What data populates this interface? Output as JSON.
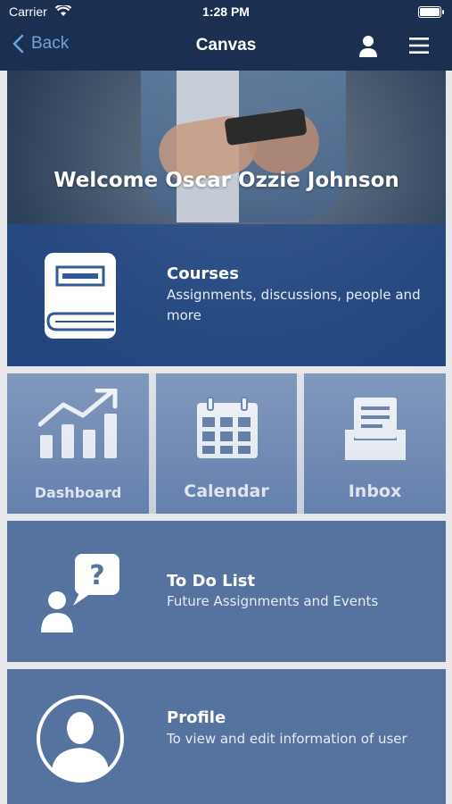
{
  "status": {
    "carrier": "Carrier",
    "time": "1:28 PM"
  },
  "nav": {
    "back_label": "Back",
    "title": "Canvas"
  },
  "hero": {
    "welcome": "Welcome Oscar Ozzie Johnson"
  },
  "courses": {
    "title": "Courses",
    "subtitle": "Assignments, discussions, people and more"
  },
  "tiles": {
    "dashboard": "Dashboard",
    "calendar": "Calendar",
    "inbox": "Inbox"
  },
  "todo": {
    "title": "To Do List",
    "subtitle": "Future Assignments and Events"
  },
  "profile": {
    "title": "Profile",
    "subtitle": "To view and edit information of user"
  },
  "colors": {
    "navbar": "#1b3050",
    "back": "#6fa3d9",
    "tile": "#56739f"
  },
  "icons": [
    "wifi-icon",
    "battery-icon",
    "back-chevron-icon",
    "user-icon",
    "menu-icon",
    "book-icon",
    "chart-icon",
    "calendar-icon",
    "inbox-icon",
    "question-chat-icon",
    "profile-silhouette-icon"
  ]
}
